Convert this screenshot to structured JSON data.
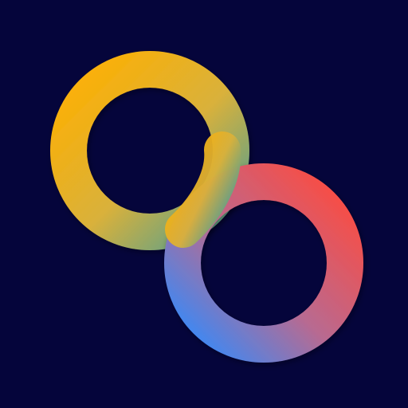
{
  "logo": {
    "icon_name": "interlocking-rings-logo-icon",
    "background_color": "#05053b",
    "ring_top": {
      "gradient_start": "#ffb000",
      "gradient_mid": "#d9b13b",
      "gradient_end": "#4f9f92"
    },
    "ring_bottom": {
      "gradient_start": "#ff4a3d",
      "gradient_mid": "#b86a91",
      "gradient_end": "#2f8cff"
    }
  }
}
